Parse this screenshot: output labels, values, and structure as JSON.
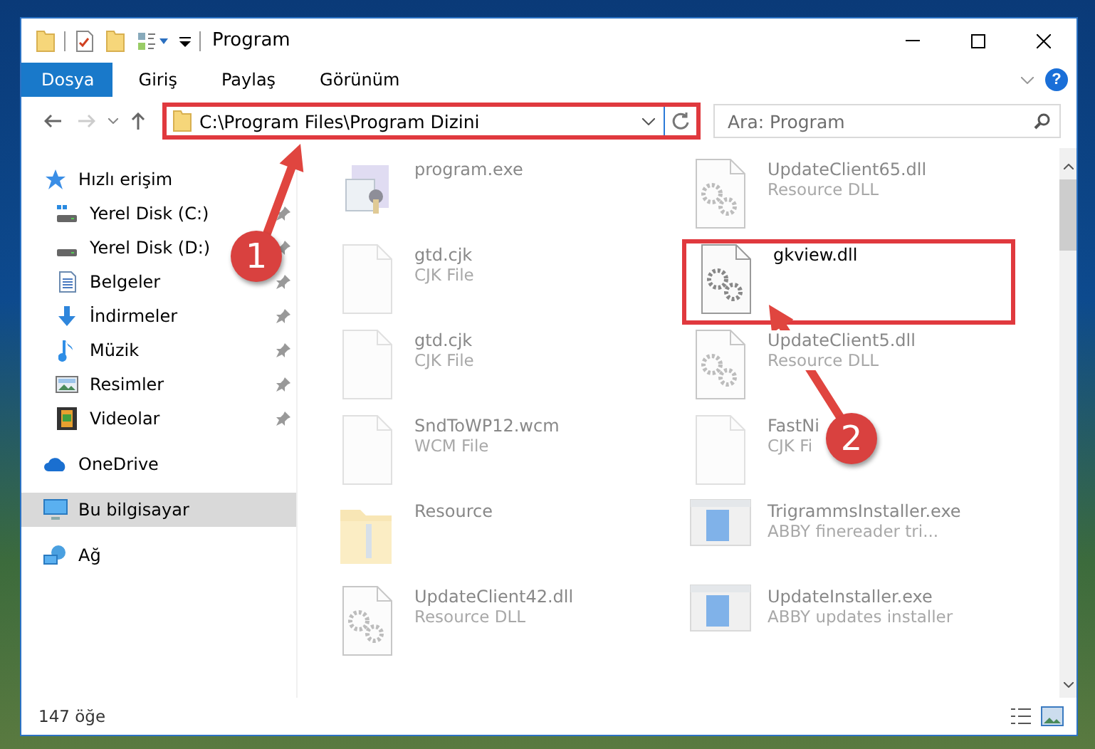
{
  "window": {
    "title": "Program"
  },
  "ribbon": {
    "tabs": [
      {
        "label": "Dosya",
        "selected": true
      },
      {
        "label": "Giriş",
        "selected": false
      },
      {
        "label": "Paylaş",
        "selected": false
      },
      {
        "label": "Görünüm",
        "selected": false
      }
    ],
    "help": "?"
  },
  "address_bar": {
    "path": "C:\\Program Files\\Program Dizini",
    "highlighted": true
  },
  "search": {
    "placeholder": "Ara: Program"
  },
  "sidebar": {
    "items": [
      {
        "label": "Hızlı erişim",
        "kind": "star",
        "selected": false,
        "children": [
          {
            "label": "Yerel Disk (C:)",
            "kind": "drive-c",
            "pinned": true,
            "selected": false
          },
          {
            "label": "Yerel Disk (D:)",
            "kind": "drive",
            "pinned": true,
            "selected": false
          },
          {
            "label": "Belgeler",
            "kind": "docs",
            "pinned": true,
            "selected": false
          },
          {
            "label": "İndirmeler",
            "kind": "download",
            "pinned": true,
            "selected": false
          },
          {
            "label": "Müzik",
            "kind": "music",
            "pinned": true,
            "selected": false
          },
          {
            "label": "Resimler",
            "kind": "pictures",
            "pinned": true,
            "selected": false
          },
          {
            "label": "Videolar",
            "kind": "video",
            "pinned": true,
            "selected": false
          }
        ]
      },
      {
        "label": "OneDrive",
        "kind": "cloud",
        "selected": false
      },
      {
        "label": "Bu bilgisayar",
        "kind": "computer",
        "selected": true
      },
      {
        "label": "Ağ",
        "kind": "network",
        "selected": false
      }
    ]
  },
  "files": [
    {
      "name": "program.exe",
      "kind": "exe",
      "blurred": true,
      "highlighted": false
    },
    {
      "name": "UpdateClient65.dll",
      "type": "Resource DLL",
      "kind": "dll",
      "blurred": true,
      "highlighted": false
    },
    {
      "name": "gtd.cjk",
      "type": "CJK File",
      "kind": "blank",
      "blurred": true,
      "highlighted": false
    },
    {
      "name": "gkview.dll",
      "kind": "dll",
      "blurred": false,
      "highlighted": true
    },
    {
      "name": "gtd.cjk",
      "type": "CJK File",
      "kind": "blank",
      "blurred": true,
      "highlighted": false
    },
    {
      "name": "UpdateClient5.dll",
      "type": "Resource DLL",
      "kind": "dll",
      "blurred": true,
      "highlighted": false
    },
    {
      "name": "SndToWP12.wcm",
      "type": "WCM File",
      "kind": "blank",
      "blurred": true,
      "highlighted": false
    },
    {
      "name": "FastNi",
      "type": "CJK Fi",
      "kind": "blank",
      "blurred": true,
      "highlighted": false
    },
    {
      "name": "Resource",
      "kind": "folder",
      "blurred": true,
      "highlighted": false
    },
    {
      "name": "TrigrammsInstaller.exe",
      "type": "ABBY finereader tri...",
      "kind": "installer",
      "blurred": true,
      "highlighted": false
    },
    {
      "name": "UpdateClient42.dll",
      "type": "Resource DLL",
      "kind": "dll",
      "blurred": true,
      "highlighted": false
    },
    {
      "name": "UpdateInstaller.exe",
      "type": "ABBY updates installer",
      "kind": "installer",
      "blurred": true,
      "highlighted": false
    }
  ],
  "status_bar": {
    "count": "147 öğe"
  },
  "annotations": [
    {
      "label": "1"
    },
    {
      "label": "2"
    }
  ]
}
